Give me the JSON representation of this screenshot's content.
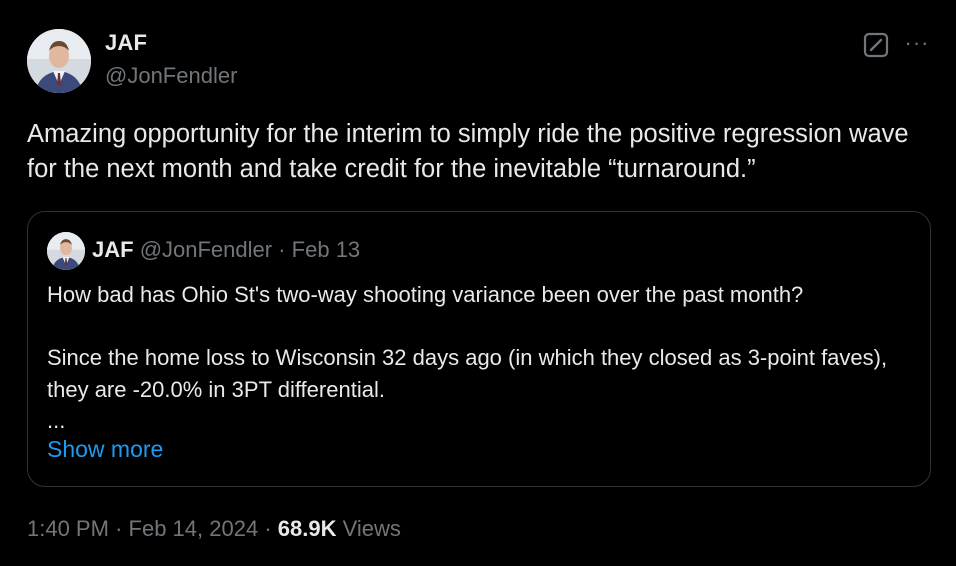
{
  "author": {
    "display_name": "JAF",
    "handle": "@JonFendler"
  },
  "header_icons": [
    "grok-icon",
    "more-icon"
  ],
  "more_glyph": "···",
  "tweet": {
    "text": "Amazing opportunity for the interim to simply ride the positive regression wave for the next month and take credit for the inevitable “turnaround.”"
  },
  "quoted": {
    "display_name": "JAF",
    "handle": "@JonFendler",
    "separator": "·",
    "date": "Feb 13",
    "paragraph1": "How bad has Ohio St's two-way shooting variance been over the past month?",
    "paragraph2": "Since the home loss to Wisconsin 32 days ago (in which they closed as 3-point faves), they are -20.0% in 3PT differential.",
    "ellipsis": "...",
    "show_more": "Show more"
  },
  "footer": {
    "time": "1:40 PM",
    "separator": "·",
    "date": "Feb 14, 2024",
    "views_count": "68.9K",
    "views_label": "Views"
  },
  "colors": {
    "background": "#000000",
    "text": "#e7e9ea",
    "muted": "#71767b",
    "link": "#1d9bf0",
    "border": "#2f3336"
  }
}
